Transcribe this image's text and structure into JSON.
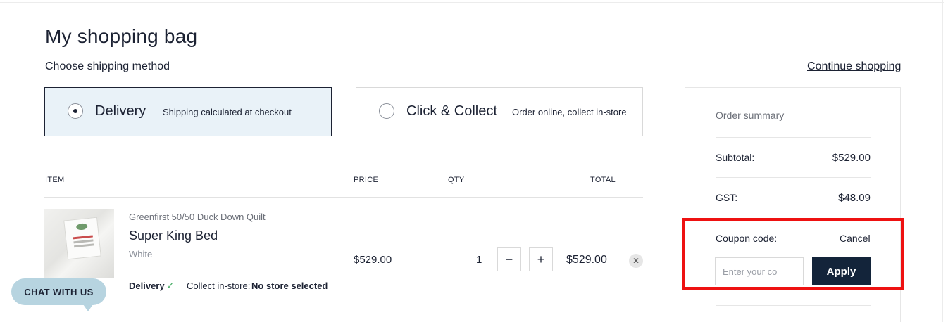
{
  "page": {
    "title": "My shopping bag",
    "shipping_label": "Choose shipping method",
    "continue_link": "Continue shopping"
  },
  "shipping": {
    "delivery": {
      "title": "Delivery",
      "subtitle": "Shipping calculated at checkout",
      "selected": true
    },
    "collect": {
      "title": "Click & Collect",
      "subtitle": "Order online, collect in-store",
      "selected": false
    }
  },
  "table": {
    "headers": {
      "item": "ITEM",
      "price": "PRICE",
      "qty": "QTY",
      "total": "TOTAL"
    },
    "rows": [
      {
        "brand": "Greenfirst 50/50 Duck Down Quilt",
        "name": "Super King Bed",
        "color": "White",
        "delivery_label": "Delivery",
        "delivery_check": "✓",
        "collect_label": "Collect in-store:",
        "store_link": "No store selected",
        "price": "$529.00",
        "qty": "1",
        "minus": "−",
        "plus": "+",
        "total": "$529.00",
        "remove": "✕"
      }
    ]
  },
  "summary": {
    "title": "Order summary",
    "subtotal_label": "Subtotal:",
    "subtotal_value": "$529.00",
    "gst_label": "GST:",
    "gst_value": "$48.09",
    "coupon_label": "Coupon code:",
    "cancel_label": "Cancel",
    "coupon_placeholder": "Enter your co",
    "apply_label": "Apply"
  },
  "chat": {
    "label": "CHAT WITH US"
  },
  "colors": {
    "accent": "#13243a",
    "selected_bg": "#e9f2f8",
    "highlight": "#ee1111",
    "chat_bg": "#b7d4e0"
  }
}
